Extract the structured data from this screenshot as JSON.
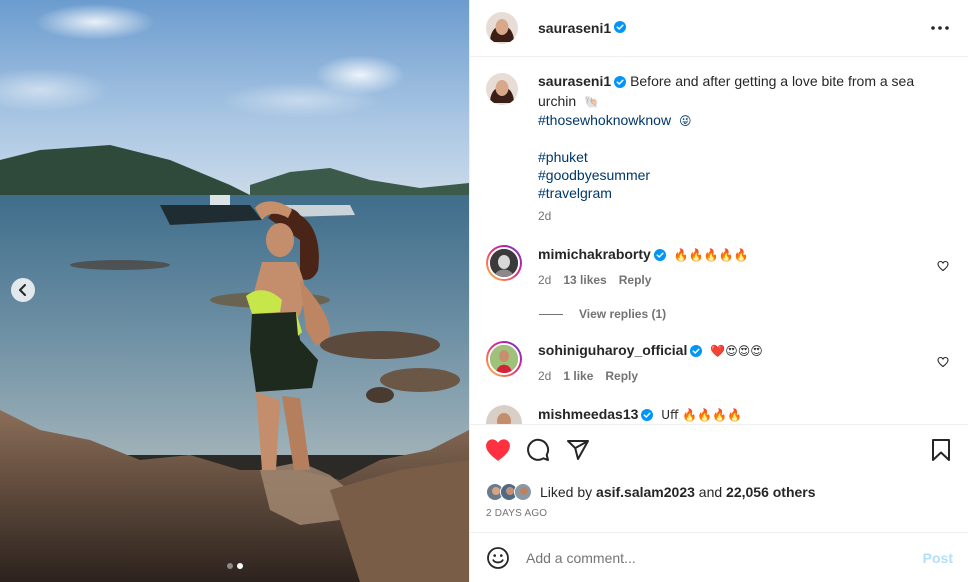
{
  "post": {
    "username": "sauraseni1",
    "verified": true,
    "caption_text": "Before and after getting a love bite from a sea urchin",
    "caption_emoji": "🐚",
    "hashtags": [
      "#thosewhoknowknow",
      "#phuket",
      "#goodbyesummer",
      "#travelgram"
    ],
    "hashtag_emoji": "😜",
    "age": "2d"
  },
  "comments": [
    {
      "username": "mimichakraborty",
      "verified": true,
      "text": "🔥🔥🔥🔥🔥",
      "age": "2d",
      "likes": "13 likes",
      "reply": "Reply",
      "view_replies": "View replies (1)"
    },
    {
      "username": "sohiniguharoy_official",
      "verified": true,
      "text": "❤️😍😍😍",
      "age": "2d",
      "likes": "1 like",
      "reply": "Reply"
    },
    {
      "username": "mishmeedas13",
      "verified": true,
      "text": "Uff 🔥🔥🔥🔥"
    }
  ],
  "likes": {
    "prefix": "Liked by",
    "user": "asif.salam2023",
    "joiner": "and",
    "others": "22,056 others"
  },
  "timestamp": "2 DAYS AGO",
  "comment_box": {
    "placeholder": "Add a comment...",
    "post_label": "Post"
  },
  "carousel": {
    "slide": 2,
    "total": 2
  },
  "colors": {
    "like_red": "#ff3040",
    "link": "#00376b",
    "verified": "#0095f6",
    "post_disabled": "#b2dffc"
  },
  "icons": [
    "more-icon",
    "verified-icon",
    "heart-icon",
    "comment-icon",
    "share-icon",
    "bookmark-icon",
    "emoji-icon",
    "chevron-left-icon"
  ]
}
